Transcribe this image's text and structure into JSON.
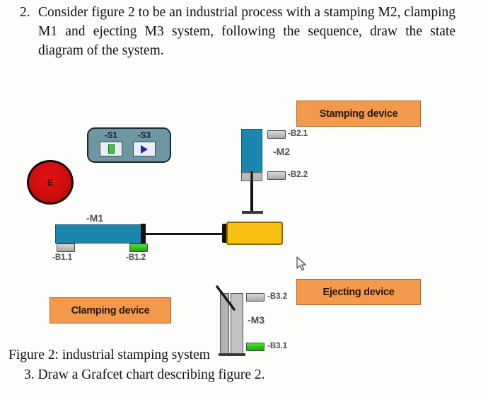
{
  "question_2": {
    "number": "2.",
    "text": "Consider figure 2 to be an industrial process with a stamping M2, clamping M1 and ejecting M3 system, following the sequence, draw the state diagram of the system."
  },
  "figure_caption": "Figure 2: industrial stamping system",
  "question_3": "3. Draw a Grafcet chart describing figure 2.",
  "diagram": {
    "callouts": {
      "stamping": "Stamping device",
      "ejecting": "Ejecting device",
      "clamping": "Clamping device"
    },
    "emergency_stop": {
      "label": "E",
      "color": "#cf0d0d"
    },
    "control_panel": {
      "buttons": [
        {
          "label": "-S1",
          "icon": "stop-bar-icon",
          "icon_color": "#3fc03f"
        },
        {
          "label": "-S3",
          "icon": "play-triangle-icon",
          "icon_color": "#2a1fb0"
        }
      ]
    },
    "actuators": [
      {
        "id": "m1",
        "label": "-M1",
        "role": "clamping",
        "color": "#1b87ad",
        "sensors": [
          {
            "label": "-B1.1",
            "state": "off"
          },
          {
            "label": "-B1.2",
            "state": "on"
          }
        ]
      },
      {
        "id": "m2",
        "label": "-M2",
        "role": "stamping",
        "color": "#1b87ad",
        "sensors": [
          {
            "label": "-B2.1",
            "state": "off"
          },
          {
            "label": "-B2.2",
            "state": "off"
          }
        ]
      },
      {
        "id": "m3",
        "label": "-M3",
        "role": "ejecting",
        "color": "#b3b3b3",
        "sensors": [
          {
            "label": "-B3.2",
            "state": "off"
          },
          {
            "label": "-B3.1",
            "state": "on"
          }
        ]
      }
    ],
    "workpiece": {
      "color": "#f7c013"
    }
  }
}
